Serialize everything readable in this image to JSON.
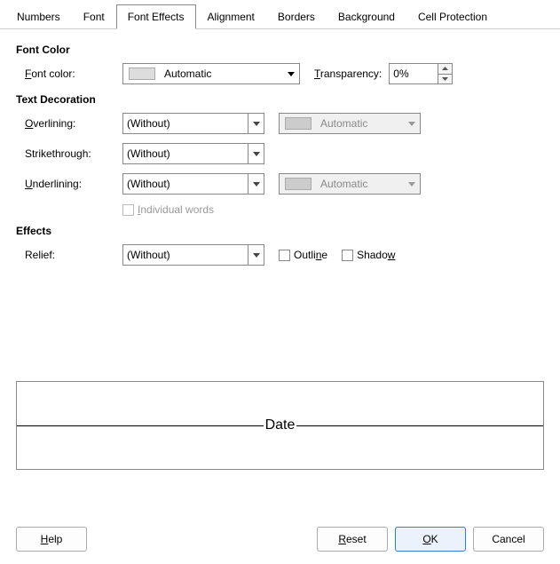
{
  "tabs": {
    "numbers": "Numbers",
    "font": "Font",
    "font_effects": "Font Effects",
    "alignment": "Alignment",
    "borders": "Borders",
    "background": "Background",
    "cell_protection": "Cell Protection"
  },
  "sections": {
    "font_color": "Font Color",
    "text_decoration": "Text Decoration",
    "effects": "Effects"
  },
  "font_color": {
    "label_pre": "F",
    "label_post": "ont color:",
    "value": "Automatic",
    "transparency_pre": "T",
    "transparency_post": "ransparency:",
    "transparency_value": "0%"
  },
  "overlining": {
    "label_pre": "O",
    "label_post": "verlining:",
    "value": "(Without)",
    "color": "Automatic"
  },
  "strikethrough": {
    "label": "Strikethrough:",
    "value": "(Without)"
  },
  "underlining": {
    "label_pre": "U",
    "label_post": "nderlining:",
    "value": "(Without)",
    "color": "Automatic"
  },
  "individual_words": {
    "label_pre": "I",
    "label_post": "ndividual words"
  },
  "relief": {
    "label": "Relief:",
    "value": "(Without)"
  },
  "outline": {
    "label_pre": "Outli",
    "label_mid": "n",
    "label_post": "e"
  },
  "shadow": {
    "label_pre": "Shado",
    "label_mid": "w"
  },
  "preview": {
    "text": "Date"
  },
  "buttons": {
    "help_pre": "H",
    "help_post": "elp",
    "reset_pre": "R",
    "reset_post": "eset",
    "ok_pre": "O",
    "ok_post": "K",
    "cancel": "Cancel"
  }
}
